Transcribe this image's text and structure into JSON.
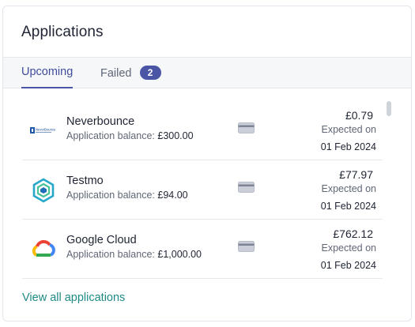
{
  "card": {
    "title": "Applications"
  },
  "tabs": [
    {
      "label": "Upcoming",
      "active": true
    },
    {
      "label": "Failed",
      "badge": "2"
    }
  ],
  "balance_label": "Application balance:",
  "expected_label": "Expected on",
  "applications": [
    {
      "name": "Neverbounce",
      "balance": "£300.00",
      "amount": "£0.79",
      "date": "01 Feb 2024",
      "logo_icon": "neverbounce-logo-icon",
      "logo_text": "NeverBounce"
    },
    {
      "name": "Testmo",
      "balance": "£94.00",
      "amount": "£77.97",
      "date": "01 Feb 2024",
      "logo_icon": "testmo-logo-icon"
    },
    {
      "name": "Google Cloud",
      "balance": "£1,000.00",
      "amount": "£762.12",
      "date": "01 Feb 2024",
      "logo_icon": "google-cloud-logo-icon"
    }
  ],
  "payment_icon": "credit-card-icon",
  "footer": {
    "view_all_label": "View all applications"
  },
  "colors": {
    "accent": "#4b54a8",
    "badge": "#4b55a6",
    "link": "#1f8a86",
    "border": "#e3e6ec",
    "tabbar_bg": "#f6f7f9"
  }
}
